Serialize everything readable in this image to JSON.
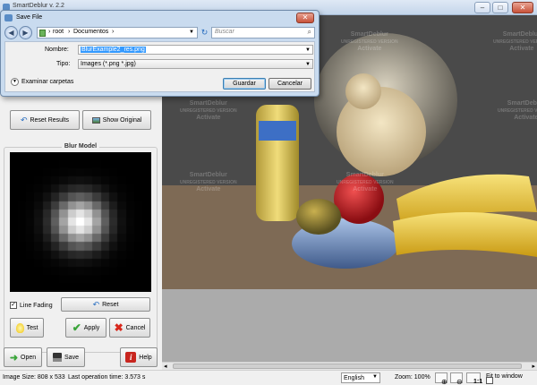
{
  "app": {
    "title": "SmartDeblur v. 2.2"
  },
  "dialog": {
    "title": "Save File",
    "address_path": [
      "root",
      "Documentos"
    ],
    "search_placeholder": "Buscar",
    "name_label": "Nombre:",
    "name_value": "BlurExample2_res.png",
    "type_label": "Tipo:",
    "type_value": "Images (*.png *.jpg)",
    "browse_label": "Examinar carpetas",
    "save_label": "Guardar",
    "cancel_label": "Cancelar"
  },
  "left_panel": {
    "reset_results_label": "Reset Results",
    "show_original_label": "Show Original",
    "blur_model_title": "Blur Model",
    "line_fading_label": "Line Fading",
    "line_fading_checked": true,
    "reset_label": "Reset",
    "test_label": "Test",
    "apply_label": "Apply",
    "cancel_label": "Cancel",
    "open_label": "Open",
    "save_label": "Save",
    "help_label": "Help"
  },
  "watermark": {
    "line1": "SmartDeblur",
    "line2": "UNREGISTERED VERSION",
    "line3": "Activate"
  },
  "status": {
    "image_size": "Image Size: 808 x 533",
    "last_operation": "Last operation time: 3.573 s",
    "language": "English",
    "zoom": "Zoom: 100%",
    "zoom_1to1": "1:1",
    "fit_to_window": "Fit to window"
  },
  "colors": {
    "dialog_frame": "#c9dbef",
    "selection": "#3399ff",
    "help_red": "#c8251e",
    "apply_green": "#3aa53a",
    "cancel_red": "#d8281c"
  }
}
